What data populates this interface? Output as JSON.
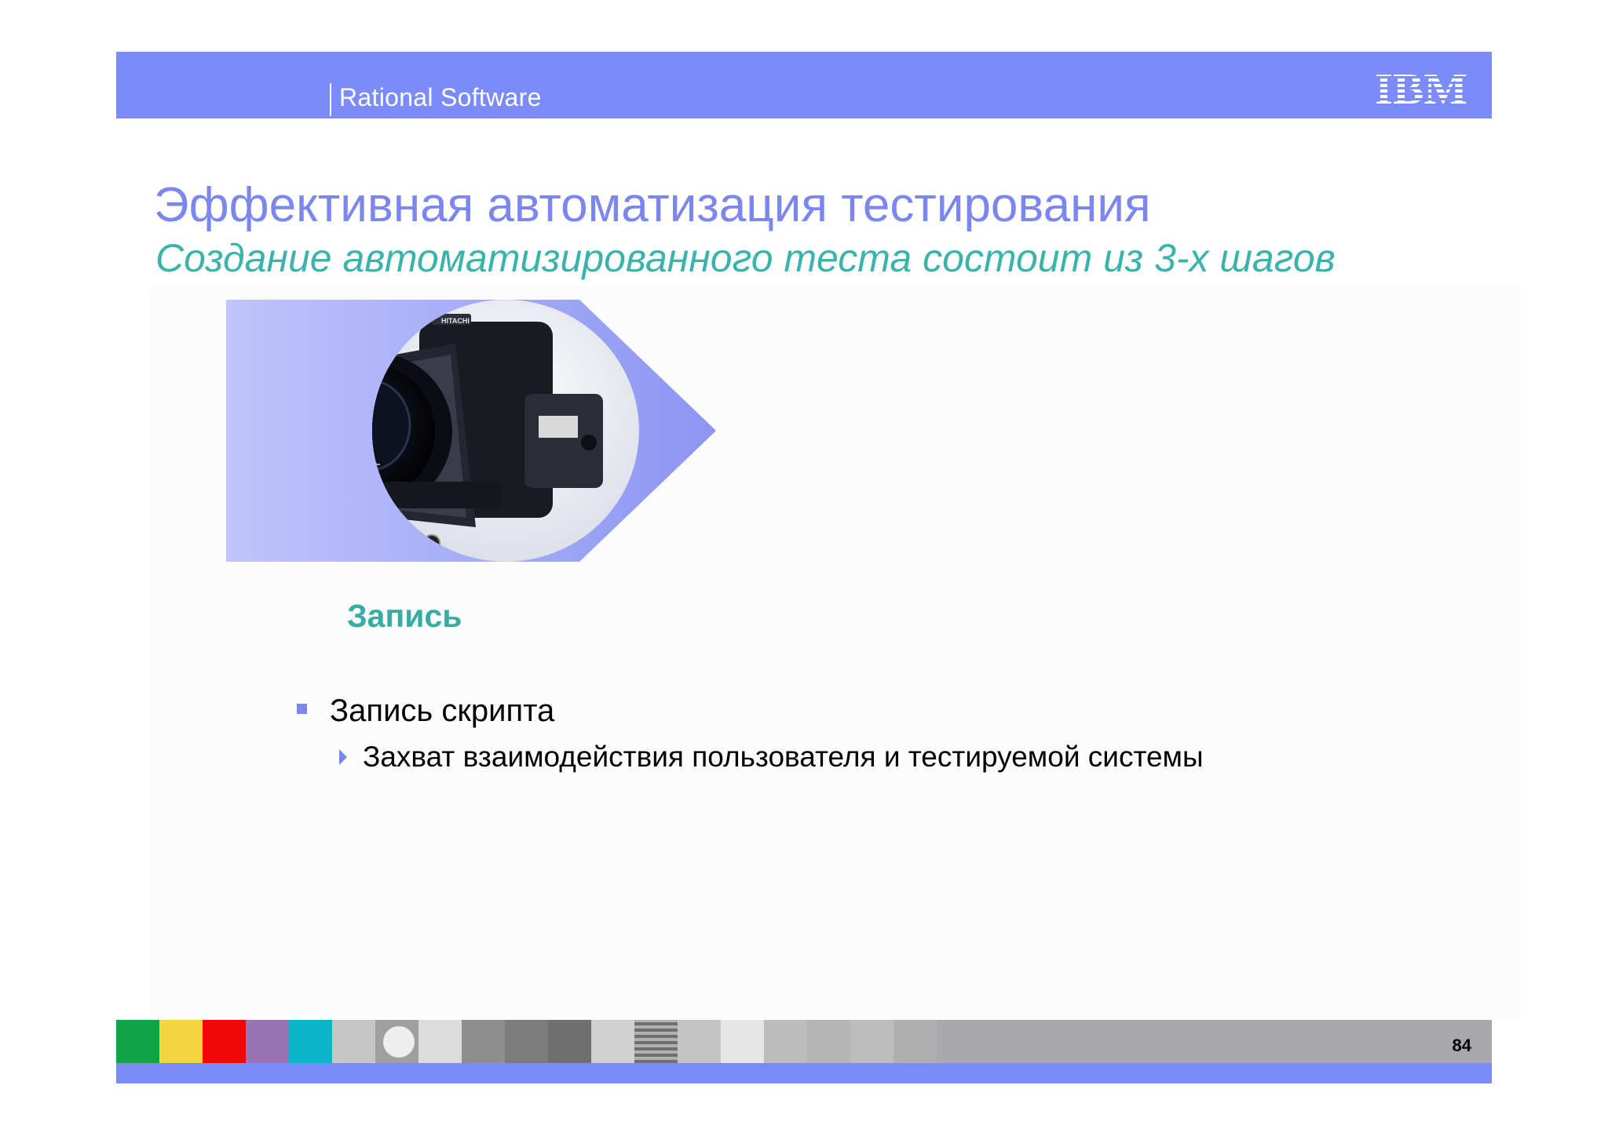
{
  "header": {
    "product": "Rational Software",
    "logo_text": "IBM",
    "background_color": "#7b8cfa"
  },
  "slide": {
    "title": "Эффективная автоматизация тестирования",
    "subtitle": "Создание автоматизированного теста состоит из 3-х шагов",
    "title_color": "#7b86f0",
    "subtitle_color": "#3ab4aa"
  },
  "step": {
    "label": "Запись",
    "image": "camera-image"
  },
  "bullets": [
    {
      "text": "Запись скрипта",
      "children": [
        "Захват взаимодействия пользователя и тестируемой системы"
      ]
    }
  ],
  "footer": {
    "page_number": "84",
    "swatch_colors": [
      "#11a34a",
      "#f5d442",
      "#f20707",
      "#9a73b5",
      "#0bb5c9"
    ]
  }
}
